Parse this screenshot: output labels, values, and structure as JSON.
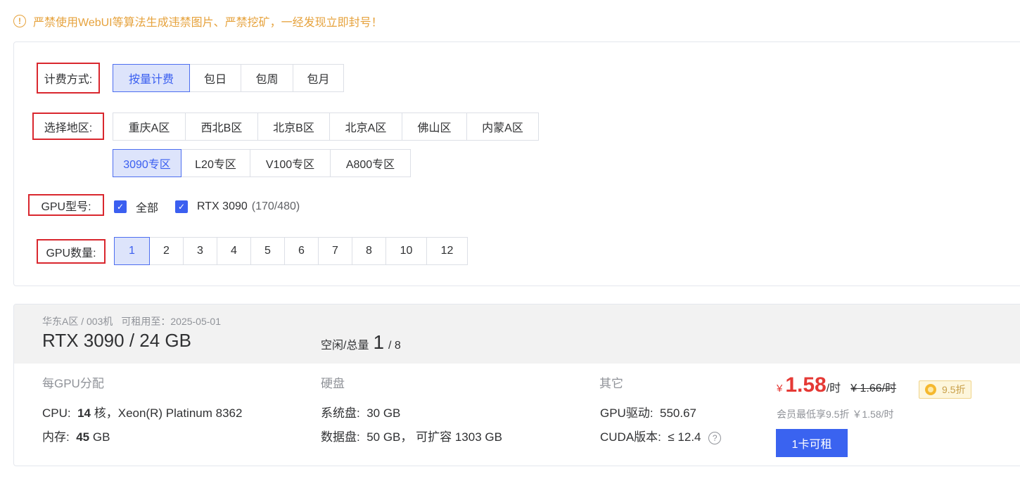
{
  "warning": {
    "icon": "exclamation-circle-icon",
    "text": "严禁使用WebUI等算法生成违禁图片、严禁挖矿，一经发现立即封号！",
    "color": "#e6a23c"
  },
  "filters": {
    "billing": {
      "label": "计费方式:",
      "options": [
        "按量计费",
        "包日",
        "包周",
        "包月"
      ],
      "selected": "按量计费"
    },
    "region": {
      "label": "选择地区:",
      "row1": [
        "重庆A区",
        "西北B区",
        "北京B区",
        "北京A区",
        "佛山区",
        "内蒙A区"
      ],
      "row2": [
        "3090专区",
        "L20专区",
        "V100专区",
        "A800专区"
      ],
      "selected": "3090专区"
    },
    "gpu_model": {
      "label": "GPU型号:",
      "all_label": "全部",
      "model_label": "RTX 3090",
      "model_count": "(170/480)"
    },
    "gpu_count": {
      "label": "GPU数量:",
      "options": [
        "1",
        "2",
        "3",
        "4",
        "5",
        "6",
        "7",
        "8",
        "10",
        "12"
      ],
      "selected": "1"
    }
  },
  "result": {
    "region": "华东A区 / 003机",
    "available_until": "可租用至：2025-05-01",
    "title": "RTX 3090 / 24 GB",
    "idle_label": "空闲/总量",
    "idle": "1",
    "total": "/ 8",
    "per_gpu": {
      "title": "每GPU分配",
      "cpu_label": "CPU:",
      "cpu_cores": "14",
      "cpu_rest": "核，Xeon(R) Platinum 8362",
      "mem_label": "内存:",
      "mem_value": "45",
      "mem_unit": "GB"
    },
    "disk": {
      "title": "硬盘",
      "sys_label": "系统盘:",
      "sys_value": "30 GB",
      "data_label": "数据盘:",
      "data_value": "50 GB， 可扩容 1303 GB"
    },
    "other": {
      "title": "其它",
      "driver_label": "GPU驱动:",
      "driver_value": "550.67",
      "cuda_label": "CUDA版本:",
      "cuda_value": "≤ 12.4",
      "help_icon": "question-circle-icon"
    },
    "price": {
      "currency": "¥",
      "value": "1.58",
      "unit": "/时",
      "original": "¥ 1.66/时",
      "discount": "9.5折",
      "member_note": "会员最低享9.5折 ￥1.58/时",
      "rent_button": "1卡可租"
    }
  }
}
